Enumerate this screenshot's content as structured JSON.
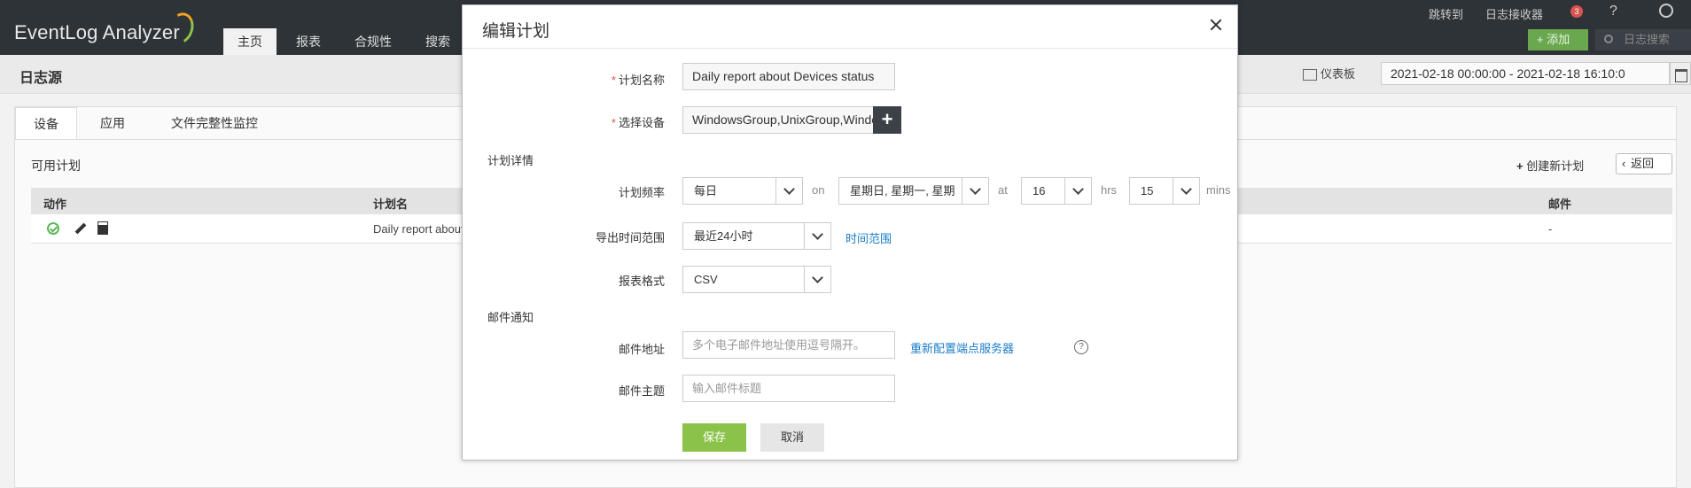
{
  "app": {
    "logo": "EventLog Analyzer"
  },
  "nav": {
    "tabs": [
      "主页",
      "报表",
      "合规性",
      "搜索"
    ]
  },
  "top": {
    "jump_to": "跳转到",
    "log_receiver": "日志接收器",
    "notif_count": "3",
    "help": "?",
    "add_label": "添加",
    "search_placeholder": "日志搜索"
  },
  "subbar": {
    "title": "日志源",
    "dashboard": "仪表板",
    "date_range": "2021-02-18 00:00:00 - 2021-02-18 16:10:0"
  },
  "content": {
    "tabs": [
      "设备",
      "应用",
      "文件完整性监控"
    ],
    "available_label": "可用计划",
    "create_label": "创建新计划",
    "back_label": "返回",
    "columns": {
      "action": "动作",
      "name": "计划名",
      "email": "邮件"
    },
    "rows": [
      {
        "name": "Daily report about",
        "email": "-"
      }
    ]
  },
  "modal": {
    "title": "编辑计划",
    "schedule_name_label": "计划名称",
    "schedule_name_value": "Daily report about Devices status",
    "devices_label": "选择设备",
    "devices_value": "WindowsGroup,UnixGroup,Windows \\",
    "details_section": "计划详情",
    "frequency_label": "计划频率",
    "frequency_value": "每日",
    "on_text": "on",
    "days_value": "星期日, 星期一, 星期",
    "at_text": "at",
    "hour_value": "16",
    "hrs_text": "hrs",
    "minute_value": "15",
    "mins_text": "mins",
    "export_range_label": "导出时间范围",
    "export_range_value": "最近24小时",
    "time_range_link": "时间范围",
    "format_label": "报表格式",
    "format_value": "CSV",
    "email_section": "邮件通知",
    "email_label": "邮件地址",
    "email_placeholder": "多个电子邮件地址使用逗号隔开。",
    "reconfigure_link": "重新配置端点服务器",
    "help_glyph": "?",
    "subject_label": "邮件主题",
    "subject_placeholder": "输入邮件标题",
    "save": "保存",
    "cancel": "取消"
  }
}
